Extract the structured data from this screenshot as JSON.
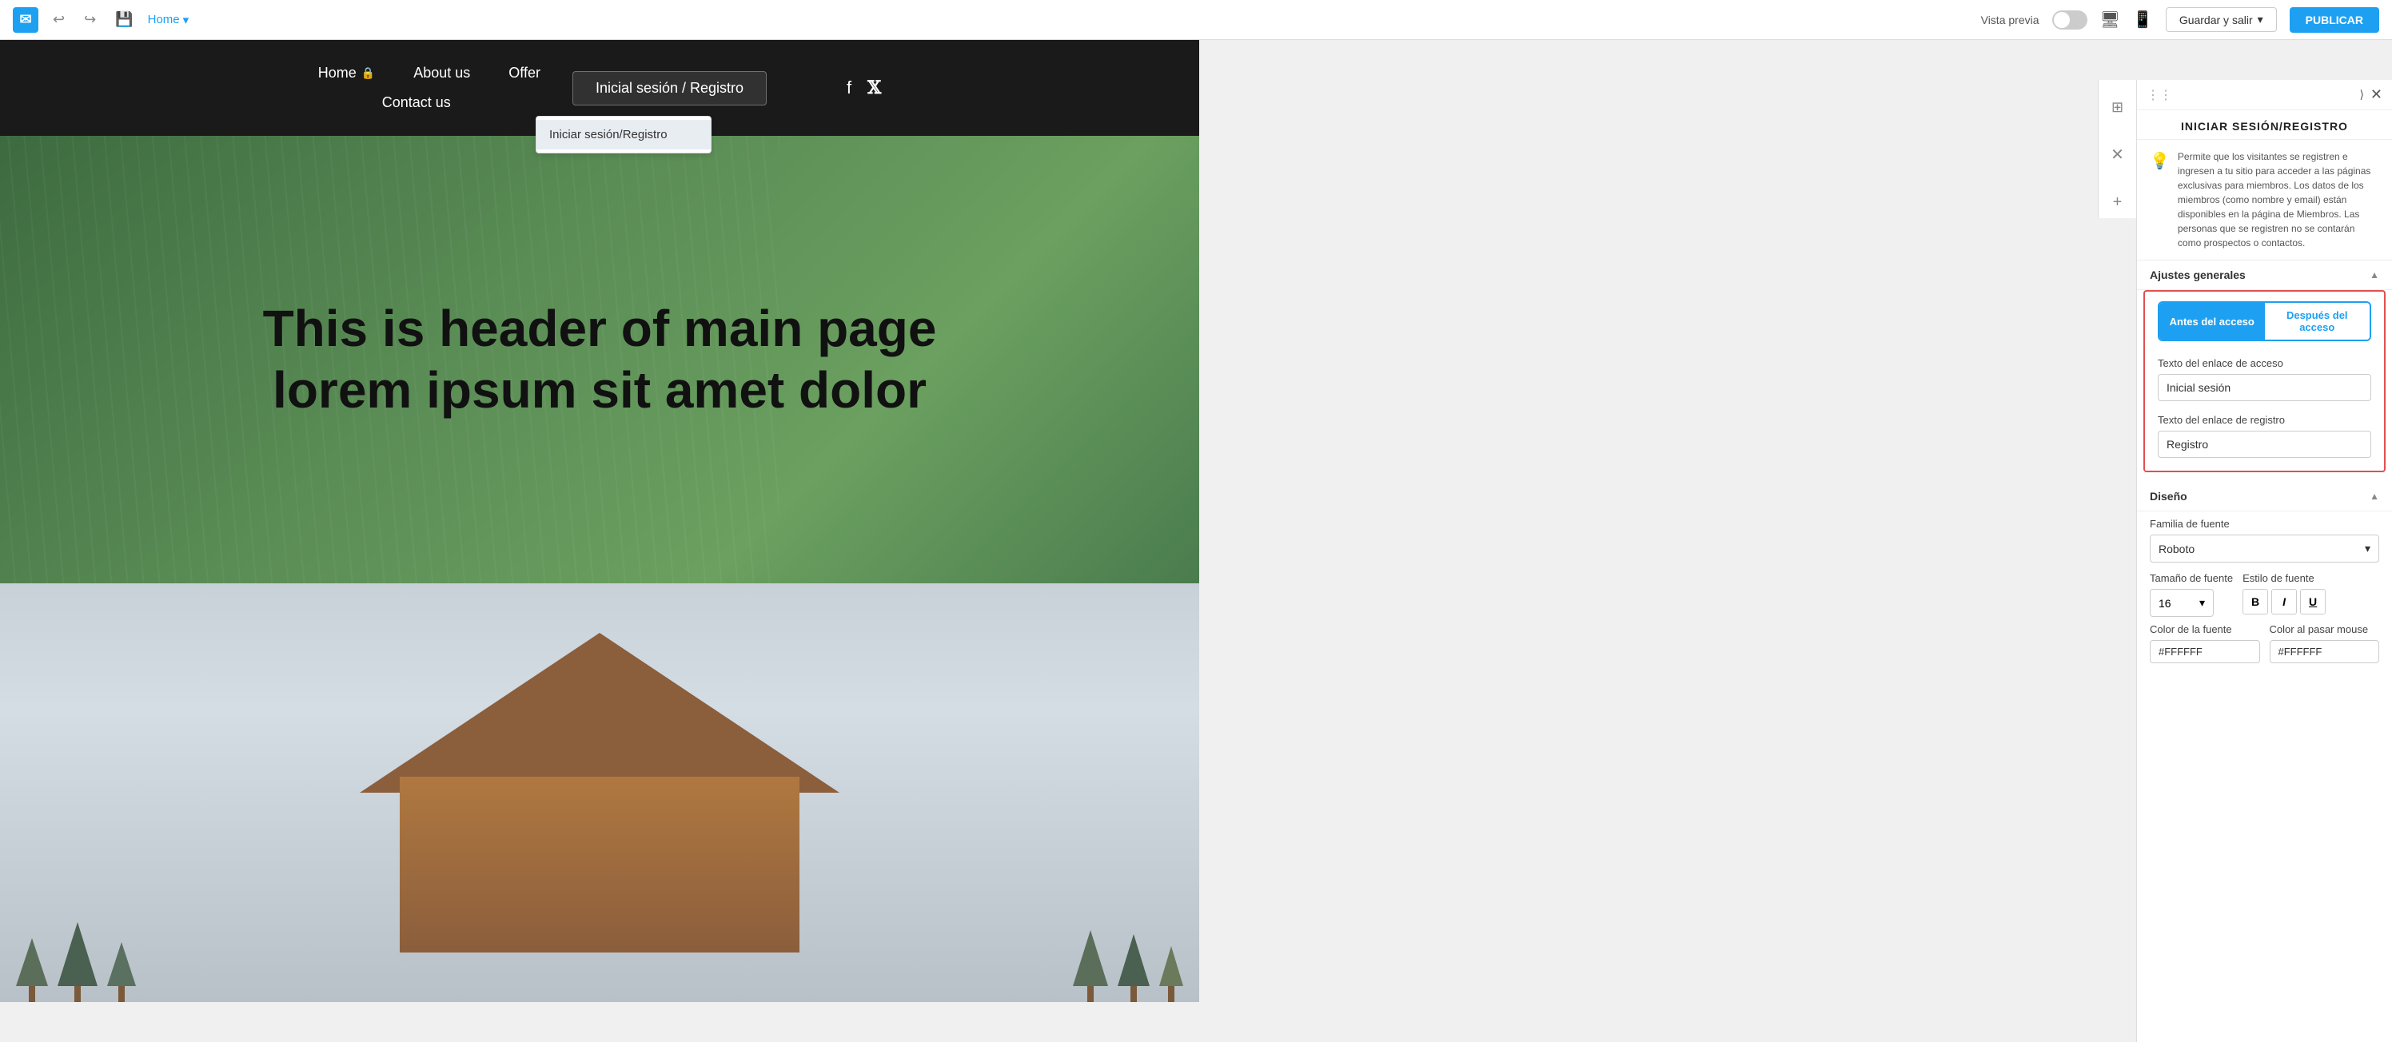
{
  "toolbar": {
    "logo": "✉",
    "page_label": "Home",
    "page_chevron": "▾",
    "undo_icon": "↩",
    "redo_icon": "↪",
    "save_icon": "💾",
    "vista_previa": "Vista previa",
    "guardar_label": "Guardar y salir",
    "guardar_chevron": "▾",
    "publicar_label": "PUBLICAR"
  },
  "site_nav": {
    "links": [
      {
        "label": "Home",
        "icon": "🔒"
      },
      {
        "label": "About us"
      },
      {
        "label": "Offer"
      }
    ],
    "contact": "Contact us",
    "login_btn": "Inicial sesión / Registro",
    "social": [
      "f",
      "𝕏"
    ],
    "login_dropdown": "Iniciar sesión/Registro"
  },
  "hero": {
    "title": "This is header of main page lorem ipsum sit amet dolor"
  },
  "panel": {
    "drag_dots": "⋮⋮",
    "close_arrow": "⟩",
    "close_x": "✕",
    "title": "INICIAR SESIÓN/REGISTRO",
    "info_icon": "💡",
    "info_text": "Permite que los visitantes se registren e ingresen a tu sitio para acceder a las páginas exclusivas para miembros. Los datos de los miembros (como nombre y email) están disponibles en la página de Miembros. Las personas que se registren no se contarán como prospectos o contactos.",
    "ajustes_generales": "Ajustes generales",
    "tab_antes": "Antes del acceso",
    "tab_despues": "Después del acceso",
    "access_link_label": "Texto del enlace de acceso",
    "access_link_value": "Inicial sesión",
    "register_link_label": "Texto del enlace de registro",
    "register_link_value": "Registro",
    "diseno_label": "Diseño",
    "font_family_label": "Familia de fuente",
    "font_family_value": "Roboto",
    "font_size_label": "Tamaño de fuente",
    "font_style_label": "Estilo de fuente",
    "font_size_value": "16",
    "bold_label": "B",
    "italic_label": "I",
    "underline_label": "U",
    "color_fuente_label": "Color de la fuente",
    "color_fuente_value": "#FFFFFF",
    "color_hover_label": "Color al pasar mouse",
    "color_hover_value": "#FFFFFF"
  }
}
